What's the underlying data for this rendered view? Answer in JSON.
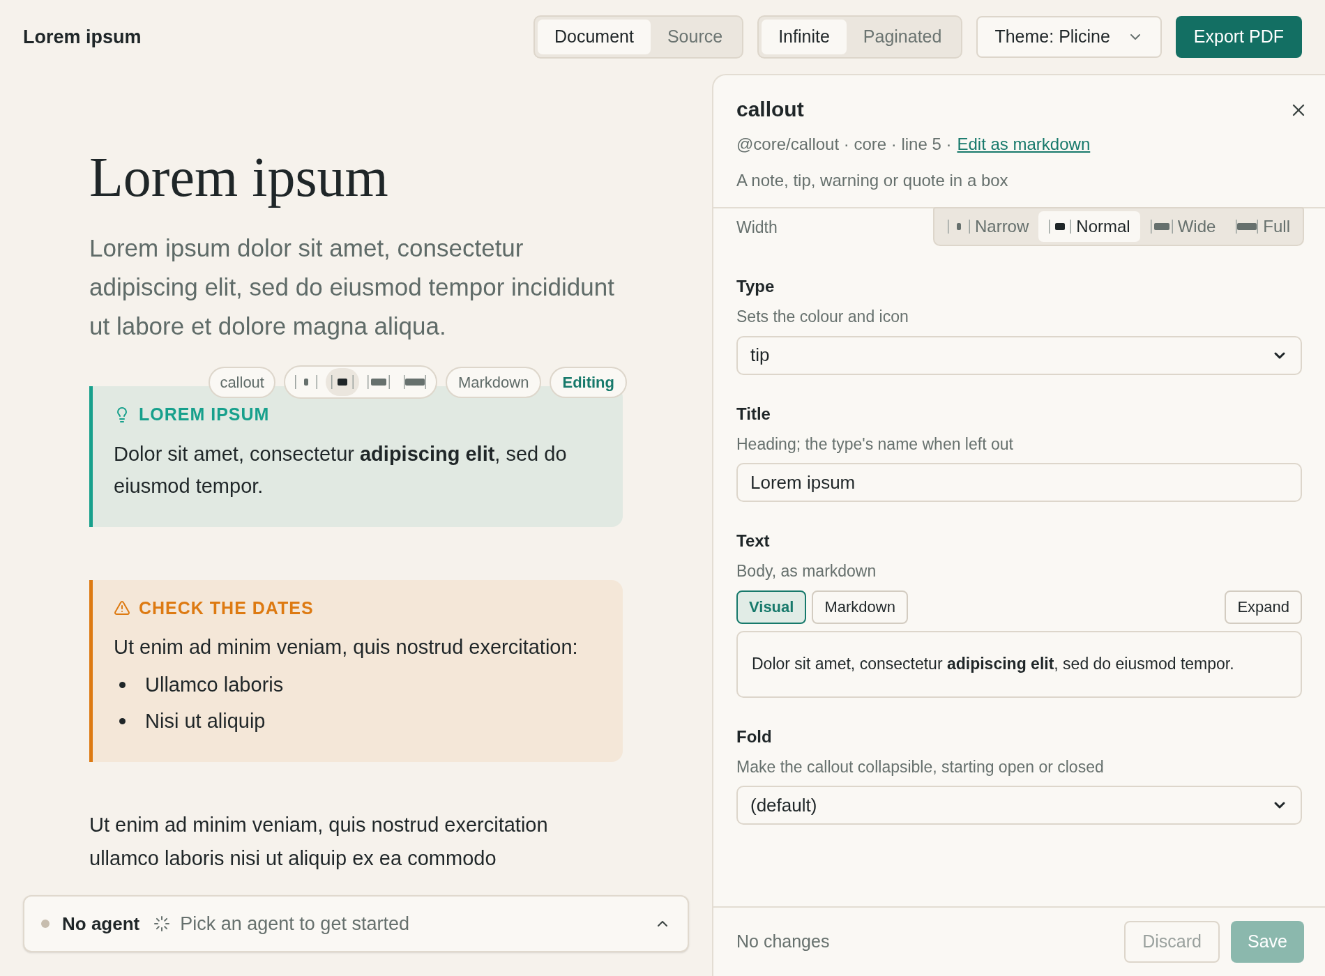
{
  "header": {
    "title": "Lorem ipsum",
    "view_tabs": [
      {
        "label": "Document",
        "selected": true
      },
      {
        "label": "Source",
        "selected": false
      }
    ],
    "layout_tabs": [
      {
        "label": "Infinite",
        "selected": true
      },
      {
        "label": "Paginated",
        "selected": false
      }
    ],
    "theme_select": {
      "value": "Theme: Plicine"
    },
    "export_button": "Export PDF"
  },
  "document": {
    "title": "Lorem ipsum",
    "lead": "Lorem ipsum dolor sit amet, consectetur adipiscing elit, sed do eiusmod tempor incididunt ut labore et dolore magna aliqua.",
    "block_toolbar": {
      "block": "callout",
      "widths": [
        {
          "kind": "narrow",
          "selected": false
        },
        {
          "kind": "normal",
          "selected": true
        },
        {
          "kind": "wide",
          "selected": false
        },
        {
          "kind": "full",
          "selected": false
        }
      ],
      "source_button": "Markdown",
      "mode_button": "Editing"
    },
    "callouts": [
      {
        "kind": "tip",
        "color": "#17a08c",
        "title": "LOREM IPSUM",
        "body": "Dolor sit amet, consectetur **adipiscing elit**, sed do eiusmod tempor."
      },
      {
        "kind": "warning",
        "color": "#dd7a12",
        "title": "CHECK THE DATES",
        "body": "Ut enim ad minim veniam, quis nostrud exercitation:",
        "items": [
          "Ullamco laboris",
          "Nisi ut aliquip"
        ]
      }
    ],
    "paragraph": "Ut enim ad minim veniam, quis nostrud exercitation ullamco laboris nisi ut aliquip ex ea commodo"
  },
  "agent_bar": {
    "status": "No agent",
    "hint": "Pick an agent to get started"
  },
  "panel": {
    "title": "callout",
    "meta": "@core/callout · core · line 5 ·",
    "edit_link": "Edit as markdown",
    "description": "A note, tip, warning or quote in a box",
    "width": {
      "label": "Width",
      "options": [
        {
          "kind": "narrow",
          "label": "Narrow",
          "selected": false
        },
        {
          "kind": "normal",
          "label": "Normal",
          "selected": true
        },
        {
          "kind": "wide",
          "label": "Wide",
          "selected": false
        },
        {
          "kind": "full",
          "label": "Full",
          "selected": false
        }
      ]
    },
    "fields": [
      {
        "kind": "select",
        "label": "Type",
        "hint": "Sets the colour and icon",
        "value": "tip"
      },
      {
        "kind": "input",
        "label": "Title",
        "hint": "Heading; the type's name when left out",
        "value": "Lorem ipsum"
      },
      {
        "kind": "editor",
        "label": "Text",
        "hint": "Body, as markdown",
        "modes": [
          {
            "label": "Visual",
            "selected": true
          },
          {
            "label": "Markdown",
            "selected": false
          }
        ],
        "expand_button": "Expand",
        "value": "Dolor sit amet, consectetur **adipiscing elit**, sed do eiusmod tempor."
      },
      {
        "kind": "select",
        "label": "Fold",
        "hint": "Make the callout collapsible, starting open or closed",
        "value": "(default)"
      }
    ],
    "footer": {
      "status": "No changes",
      "discard": {
        "label": "Discard",
        "disabled": true
      },
      "save": {
        "label": "Save",
        "disabled": true
      }
    }
  }
}
